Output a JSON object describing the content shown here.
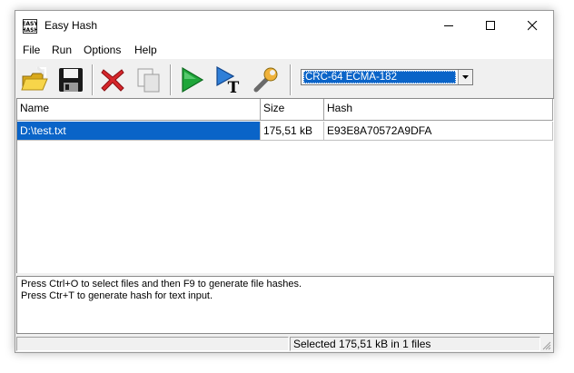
{
  "window": {
    "title": "Easy Hash",
    "app_icon_text": "EASY HASH"
  },
  "menu": [
    "File",
    "Run",
    "Options",
    "Help"
  ],
  "toolbar": {
    "buttons": [
      "open-folder-icon",
      "save-icon",
      "delete-icon",
      "copy-icon",
      "run-icon",
      "text-hash-icon",
      "settings-icon"
    ],
    "algorithm": "CRC-64 ECMA-182"
  },
  "grid": {
    "columns": [
      "Name",
      "Size",
      "Hash"
    ],
    "rows": [
      {
        "name": "D:\\test.txt",
        "size": "175,51 kB",
        "hash": "E93E8A70572A9DFA",
        "selected": true
      }
    ]
  },
  "log": [
    "Press Ctrl+O to select files and then F9 to generate file hashes.",
    "Press Ctr+T to generate hash for text input."
  ],
  "status": {
    "left": "",
    "right": "Selected 175,51 kB in 1 files"
  },
  "colors": {
    "selection": "#0a64c8",
    "window_bg": "#f0f0f0"
  }
}
